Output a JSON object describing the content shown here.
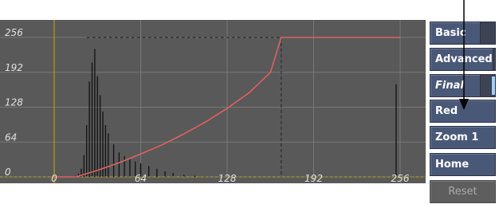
{
  "graph": {
    "y_tick_labels": [
      "256",
      "192",
      "128",
      "64",
      "0"
    ],
    "x_tick_labels": [
      "0",
      "64",
      "128",
      "192",
      "256"
    ],
    "colors": {
      "background": "#595959",
      "curve": "#e06060",
      "histogram": "#111111",
      "grid": "#787878",
      "axis": "#c8a800",
      "labels": "#e0e0e0"
    }
  },
  "chart_data": {
    "type": "line",
    "xlim": [
      0,
      256
    ],
    "ylim": [
      0,
      256
    ],
    "x_ticks": [
      0,
      64,
      128,
      192,
      256
    ],
    "y_ticks": [
      0,
      64,
      128,
      192,
      256
    ],
    "grid": true,
    "curve": {
      "x": [
        0,
        16,
        32,
        48,
        64,
        80,
        96,
        112,
        128,
        144,
        160,
        168,
        256
      ],
      "y": [
        0,
        0,
        12,
        26,
        42,
        59,
        79,
        101,
        126,
        154,
        192,
        256,
        256
      ]
    },
    "histogram": {
      "x": [
        16,
        18,
        20,
        22,
        24,
        26,
        28,
        30,
        32,
        34,
        36,
        38,
        40,
        44,
        48,
        52,
        56,
        60,
        64,
        70,
        76,
        82,
        88,
        96,
        104,
        112,
        120,
        253
      ],
      "y": [
        2,
        6,
        15,
        40,
        95,
        175,
        210,
        235,
        185,
        150,
        120,
        95,
        80,
        60,
        45,
        38,
        32,
        28,
        25,
        20,
        15,
        10,
        7,
        4,
        2,
        1,
        1,
        170
      ]
    }
  },
  "sidebar": {
    "basic": "Basic",
    "advanced": "Advanced",
    "final": "Final",
    "red": "Red",
    "zoom": "Zoom 1",
    "home": "Home",
    "reset": "Reset"
  },
  "pointer": {
    "icon": "pointer-arrow-icon"
  }
}
